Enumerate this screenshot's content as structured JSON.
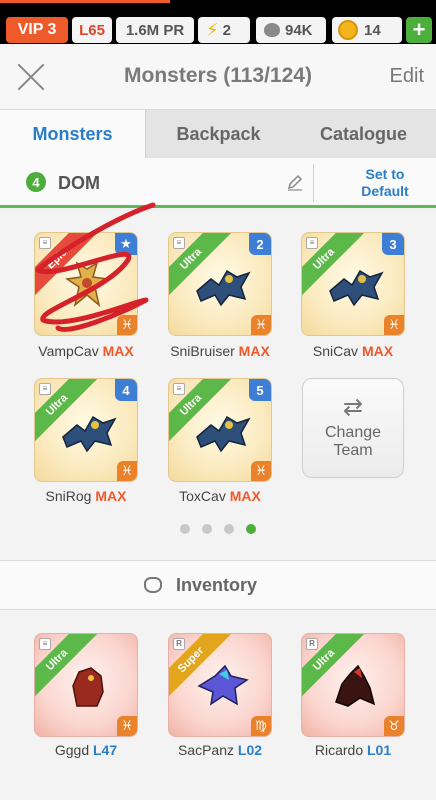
{
  "status": {
    "vip": "VIP 3",
    "level": "L65",
    "power": "1.6M PR",
    "energy": "2",
    "food": "94K",
    "gold": "14",
    "add_label": "+"
  },
  "header": {
    "title": "Monsters (113/124)",
    "edit_label": "Edit"
  },
  "tabs": [
    {
      "label": "Monsters",
      "active": true
    },
    {
      "label": "Backpack",
      "active": false
    },
    {
      "label": "Catalogue",
      "active": false
    }
  ],
  "team": {
    "number": "4",
    "name": "DOM",
    "set_default_line1": "Set to",
    "set_default_line2": "Default"
  },
  "team_monsters": [
    {
      "name": "VampCav",
      "status": "MAX",
      "rarity": "Epic",
      "slot_badge": "★"
    },
    {
      "name": "SniBruiser",
      "status": "MAX",
      "rarity": "Ultra",
      "slot_badge": "2"
    },
    {
      "name": "SniCav",
      "status": "MAX",
      "rarity": "Ultra",
      "slot_badge": "3"
    },
    {
      "name": "SniRog",
      "status": "MAX",
      "rarity": "Ultra",
      "slot_badge": "4"
    },
    {
      "name": "ToxCav",
      "status": "MAX",
      "rarity": "Ultra",
      "slot_badge": "5"
    }
  ],
  "change_team": {
    "line1": "Change",
    "line2": "Team"
  },
  "pagination": {
    "total": 4,
    "active_index": 3
  },
  "inventory": {
    "title": "Inventory",
    "items": [
      {
        "name": "Gggd",
        "level": "L47",
        "rarity": "Ultra",
        "zodiac": "♓"
      },
      {
        "name": "SacPanz",
        "level": "L02",
        "rarity": "Super",
        "zodiac": "♍"
      },
      {
        "name": "Ricardo",
        "level": "L01",
        "rarity": "Ultra",
        "zodiac": "♉"
      }
    ]
  },
  "colors": {
    "accent_orange": "#ef5a2a",
    "tab_blue": "#2a7ec8",
    "green": "#4caf3b"
  }
}
